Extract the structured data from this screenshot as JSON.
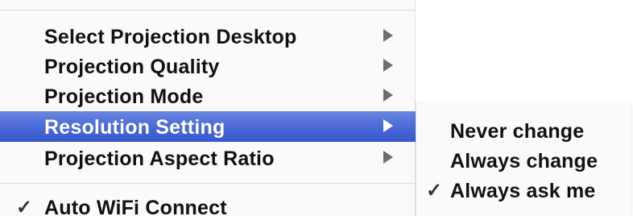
{
  "main_menu": {
    "items": [
      {
        "label": "Select Projection Desktop",
        "has_submenu": true,
        "selected": false
      },
      {
        "label": "Projection Quality",
        "has_submenu": true,
        "selected": false
      },
      {
        "label": "Projection Mode",
        "has_submenu": true,
        "selected": false
      },
      {
        "label": "Resolution Setting",
        "has_submenu": true,
        "selected": true
      },
      {
        "label": "Projection Aspect Ratio",
        "has_submenu": true,
        "selected": false
      }
    ],
    "bottom_item": {
      "label": "Auto WiFi Connect",
      "checked": true,
      "check_glyph": "✓"
    }
  },
  "submenu": {
    "items": [
      {
        "label": "Never change",
        "checked": false
      },
      {
        "label": "Always change",
        "checked": false
      },
      {
        "label": "Always ask me",
        "checked": true,
        "check_glyph": "✓"
      }
    ]
  },
  "colors": {
    "selection": "#4d6cd8",
    "menu_background": "#fafafa",
    "text": "#111111"
  },
  "icons": {
    "submenu_arrow": "chevron-right-icon",
    "checkmark": "checkmark-icon"
  }
}
